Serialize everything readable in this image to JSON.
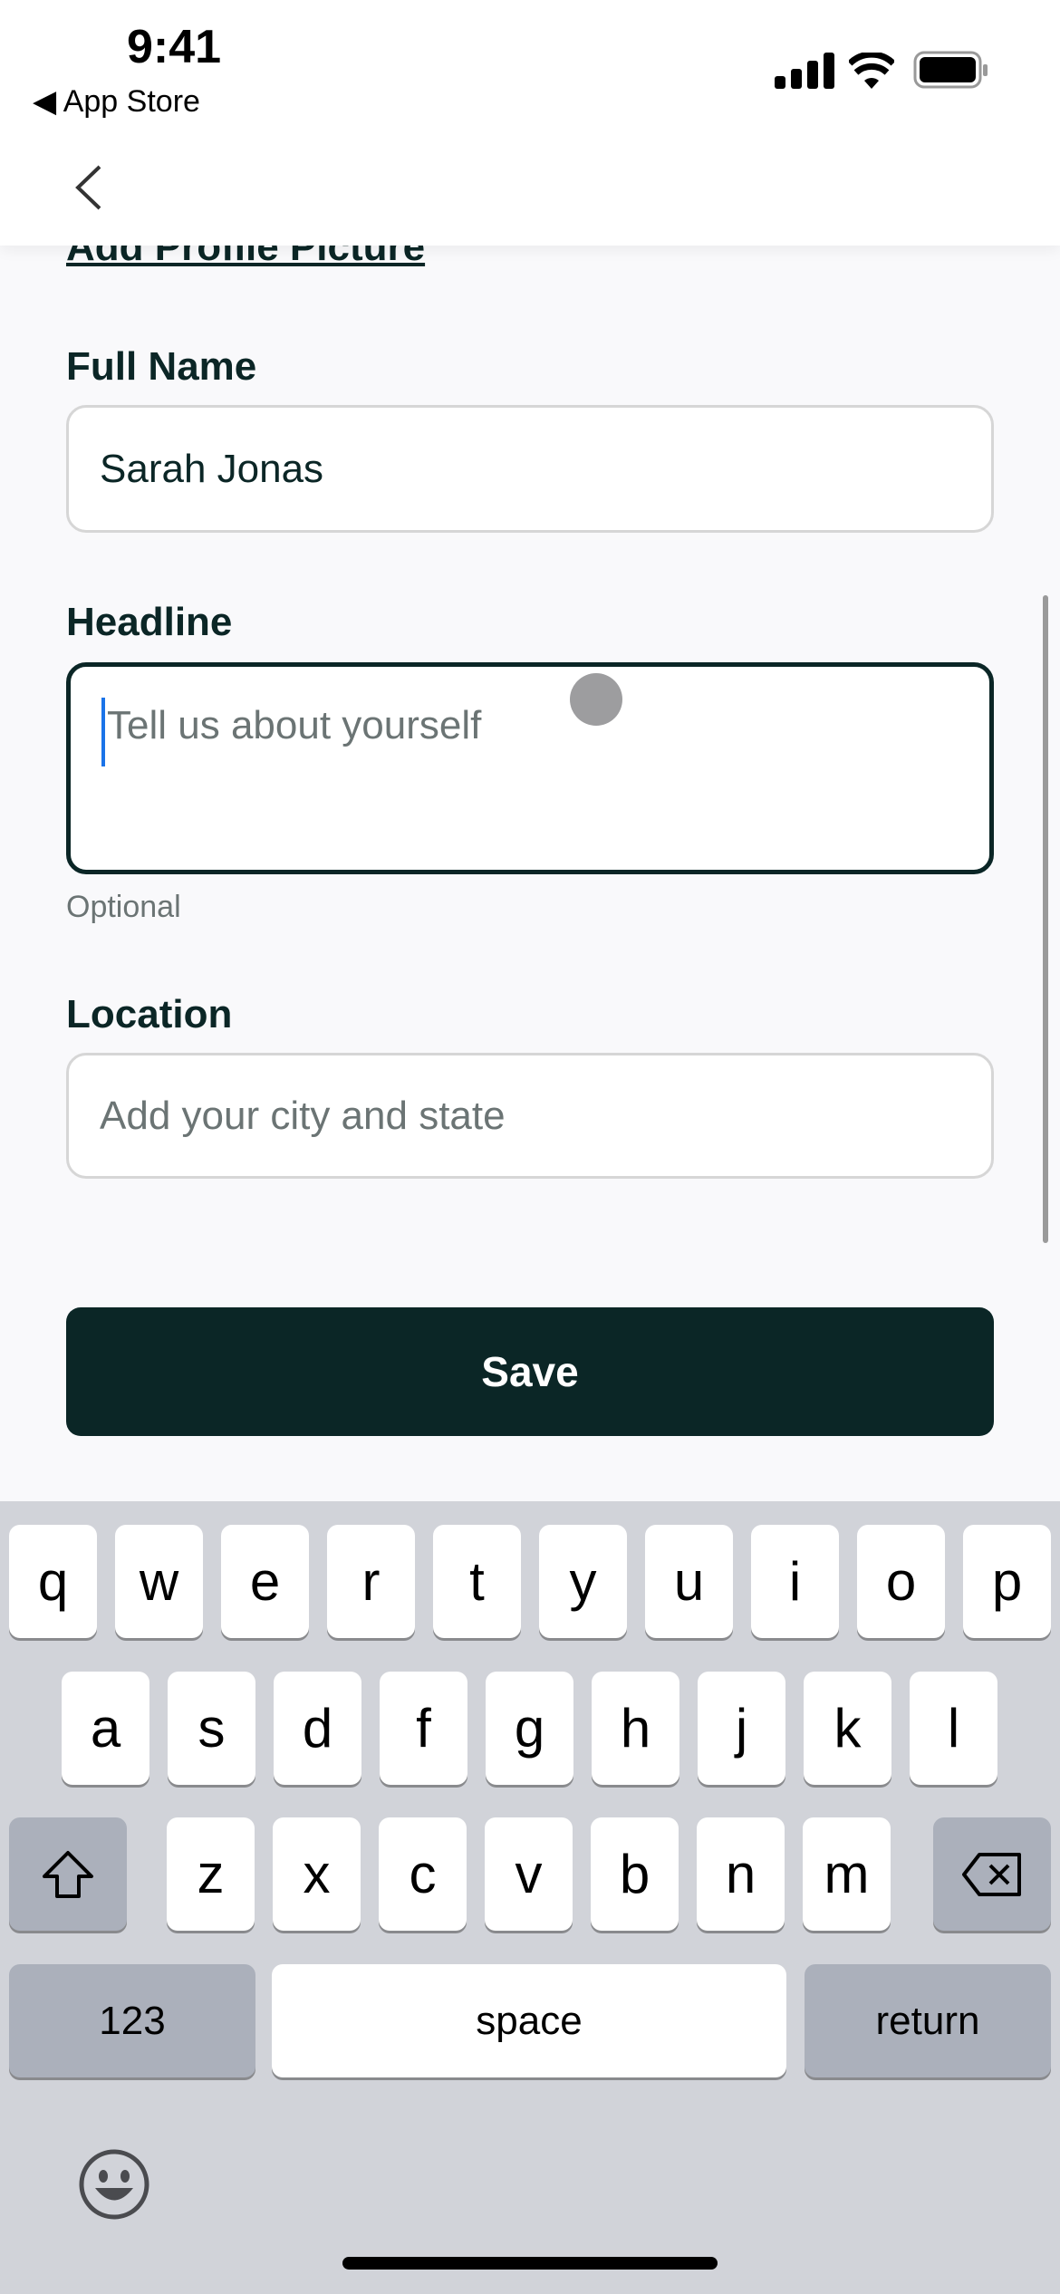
{
  "status_bar": {
    "time": "9:41",
    "back_app": "App Store"
  },
  "nav": {
    "back_icon": "chevron-left-icon"
  },
  "form": {
    "add_picture": "Add Profile Picture",
    "full_name": {
      "label": "Full Name",
      "value": "Sarah Jonas"
    },
    "headline": {
      "label": "Headline",
      "placeholder": "Tell us about yourself",
      "helper": "Optional"
    },
    "location": {
      "label": "Location",
      "placeholder": "Add your city and state"
    },
    "save": "Save"
  },
  "colors": {
    "primary": "#0b2626",
    "cursor": "#1a73e8"
  },
  "keyboard": {
    "row1": [
      "q",
      "w",
      "e",
      "r",
      "t",
      "y",
      "u",
      "i",
      "o",
      "p"
    ],
    "row2": [
      "a",
      "s",
      "d",
      "f",
      "g",
      "h",
      "j",
      "k",
      "l"
    ],
    "row3": [
      "z",
      "x",
      "c",
      "v",
      "b",
      "n",
      "m"
    ],
    "numbers": "123",
    "space": "space",
    "return": "return"
  }
}
